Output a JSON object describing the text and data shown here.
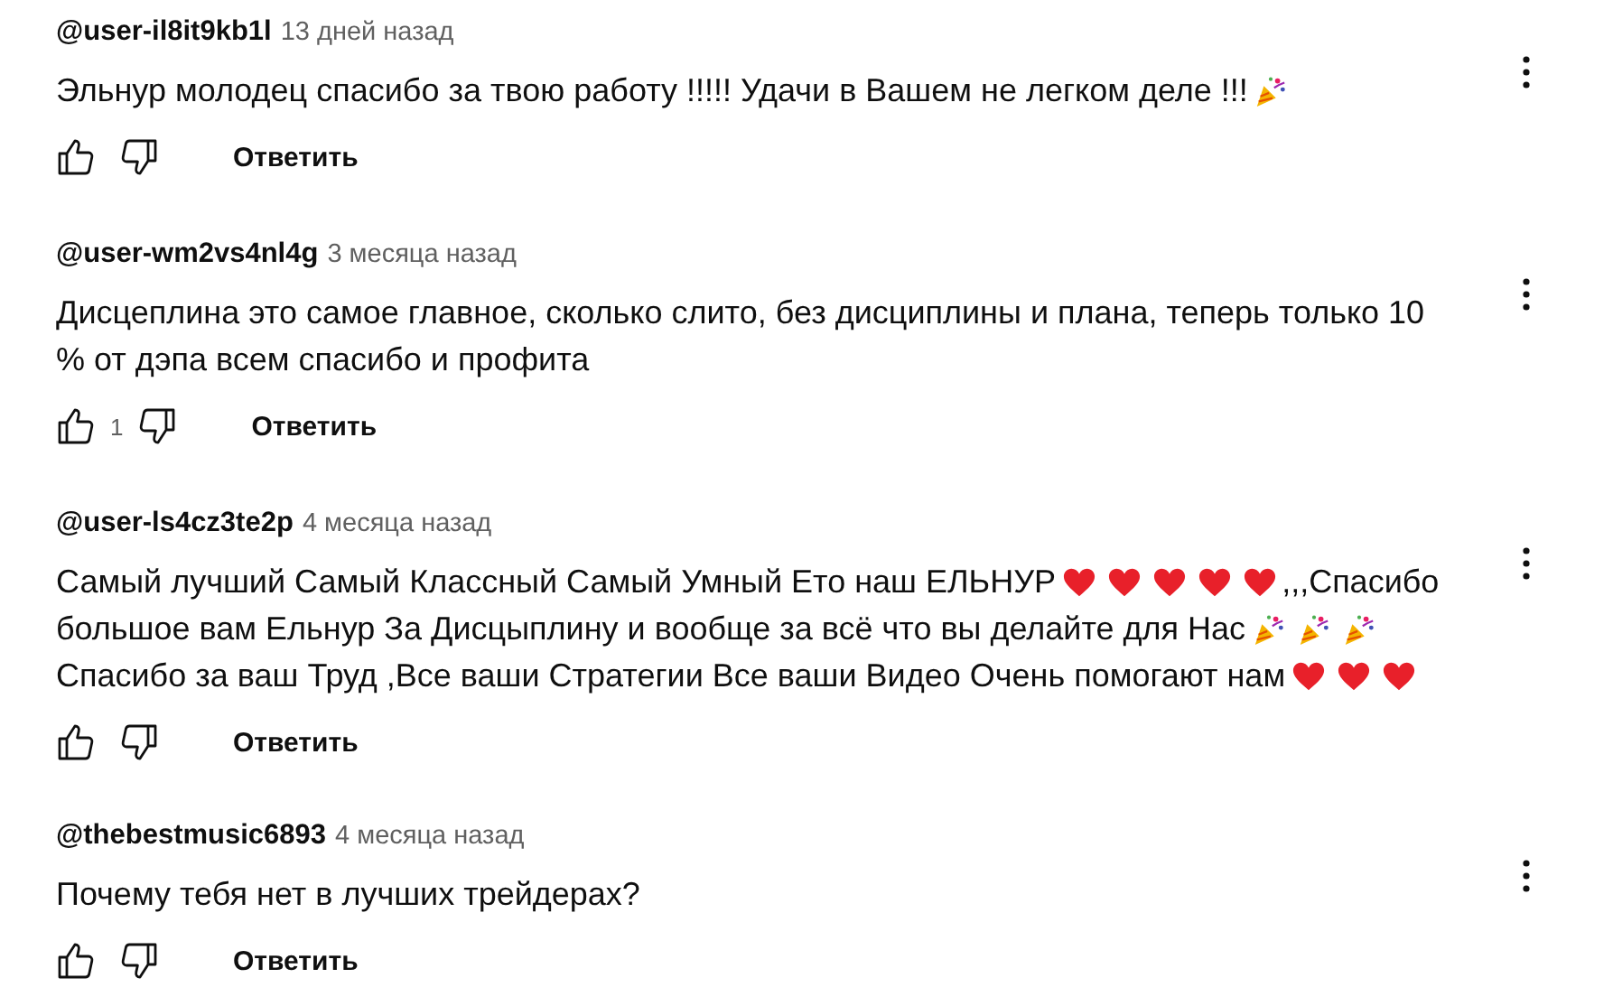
{
  "comments": [
    {
      "author": "@user-il8it9kb1l",
      "time": "13 дней назад",
      "lines": [
        [
          {
            "kind": "text",
            "text": "Эльнур молодец спасибо за твою работу !!!!! Удачи в Вашем не легком деле !!! "
          },
          {
            "kind": "party"
          }
        ]
      ],
      "reply": "Ответить"
    },
    {
      "author": "@user-wm2vs4nl4g",
      "time": "3 месяца назад",
      "lines": [
        [
          {
            "kind": "text",
            "text": "Дисцеплина это самое главное, сколько слито, без дисциплины и плана, теперь только 10"
          }
        ],
        [
          {
            "kind": "text",
            "text": "% от дэпа всем спасибо и профита"
          }
        ]
      ],
      "likes": "1",
      "reply": "Ответить"
    },
    {
      "author": "@user-ls4cz3te2p",
      "time": "4 месяца назад",
      "lines": [
        [
          {
            "kind": "text",
            "text": "Самый лучший Самый Классный Самый Умный Ето наш ЕЛЬНУР "
          },
          {
            "kind": "heart"
          },
          {
            "kind": "heart"
          },
          {
            "kind": "heart"
          },
          {
            "kind": "heart"
          },
          {
            "kind": "heart"
          },
          {
            "kind": "text",
            "text": ",,,Спасибо"
          }
        ],
        [
          {
            "kind": "text",
            "text": "большое вам Ельнур За Дисцыплину и вообще за всё что вы делайте для Нас"
          },
          {
            "kind": "party"
          },
          {
            "kind": "party"
          },
          {
            "kind": "party"
          }
        ],
        [
          {
            "kind": "text",
            "text": "Спасибо за ваш Труд ,Все ваши Стратегии Все ваши Видео Очень помогают нам"
          },
          {
            "kind": "heart"
          },
          {
            "kind": "heart"
          },
          {
            "kind": "heart"
          }
        ]
      ],
      "reply": "Ответить"
    },
    {
      "author": "@thebestmusic6893",
      "time": "4 месяца назад",
      "lines": [
        [
          {
            "kind": "text",
            "text": "Почему тебя нет в лучших трейдерах?"
          }
        ]
      ],
      "reply": "Ответить"
    }
  ]
}
